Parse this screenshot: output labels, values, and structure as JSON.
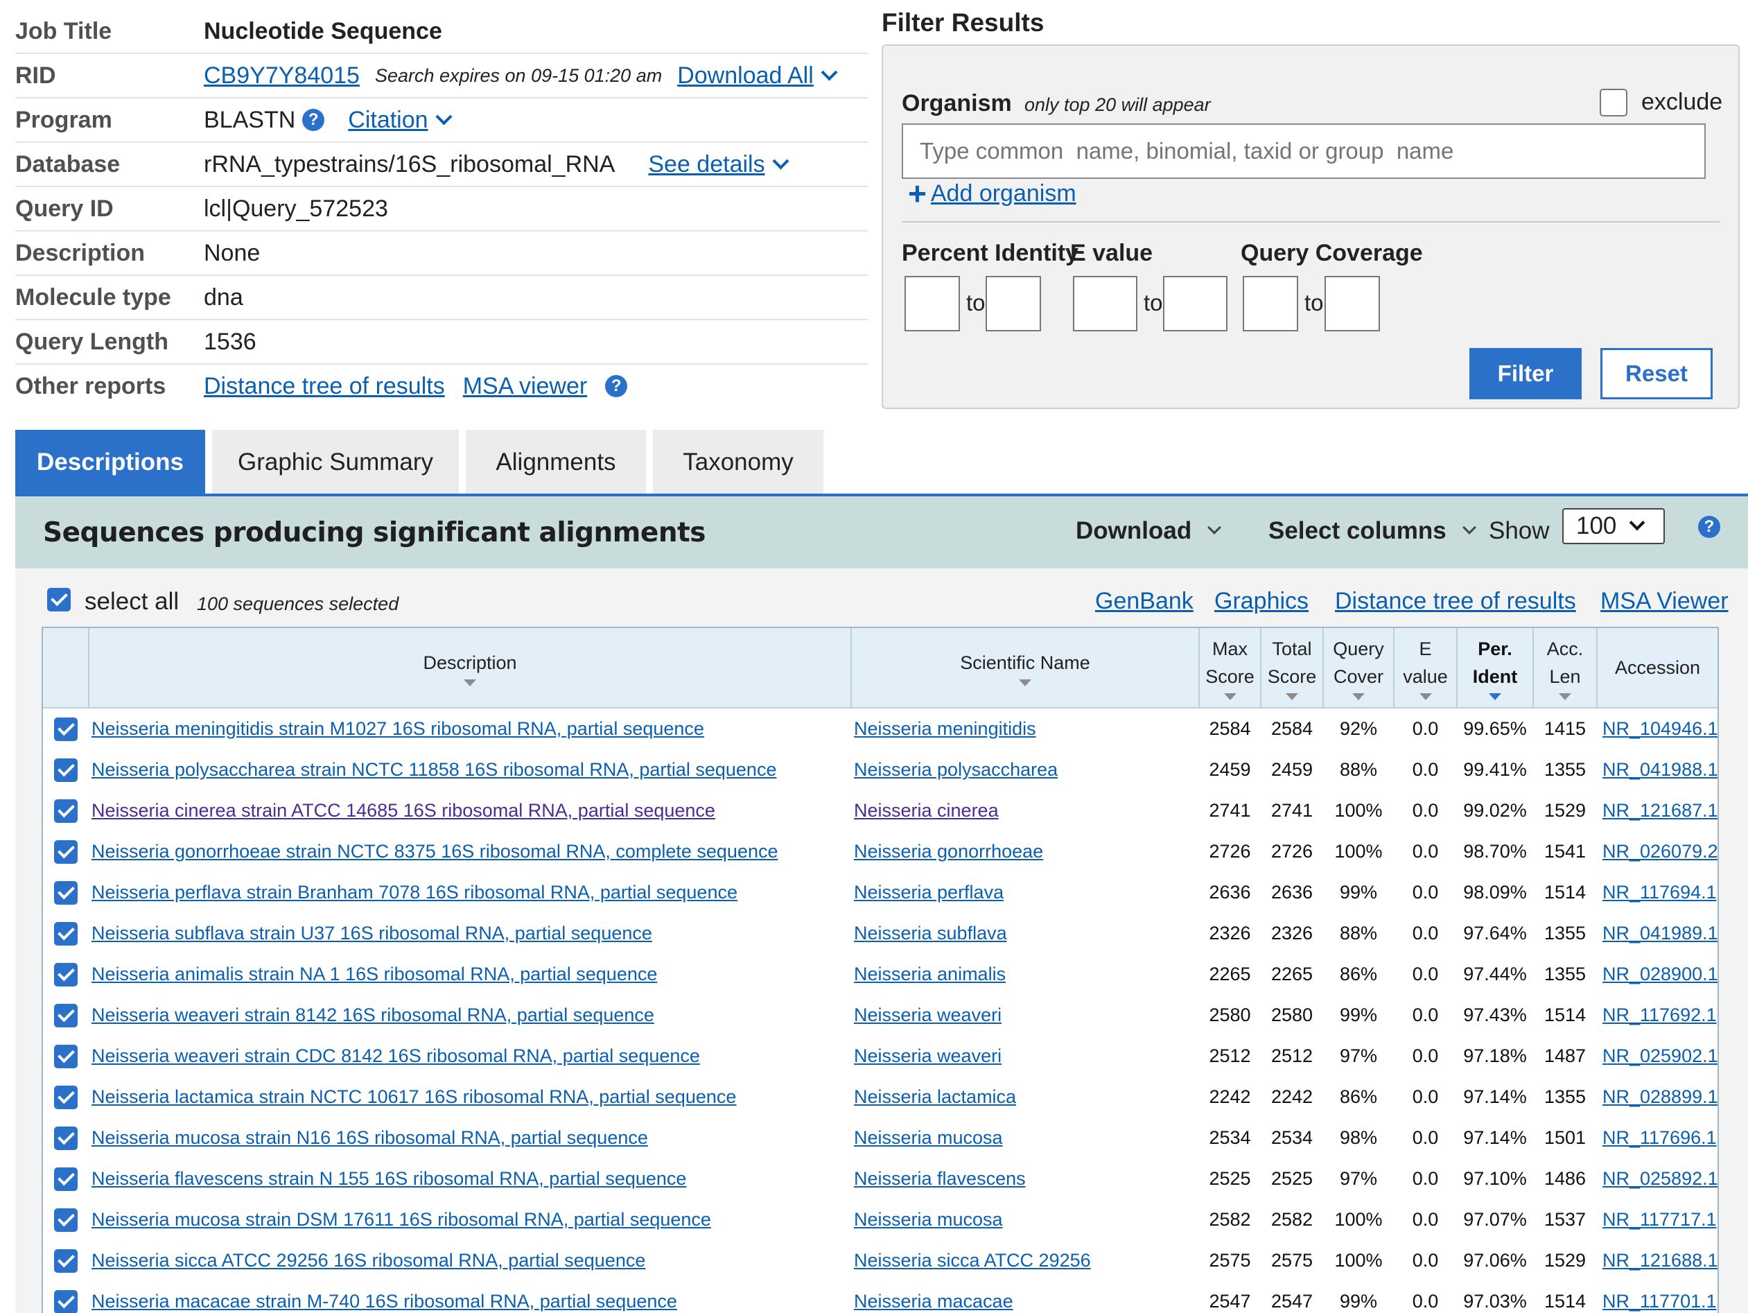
{
  "job": {
    "rows": [
      {
        "label": "Job Title",
        "value": "Nucleotide Sequence"
      },
      {
        "label": "RID",
        "value": "CB9Y7Y84015",
        "note": "Search expires on 09-15 01:20 am",
        "action": "Download All"
      },
      {
        "label": "Program",
        "value": "BLASTN",
        "action": "Citation"
      },
      {
        "label": "Database",
        "value": "rRNA_typestrains/16S_ribosomal_RNA",
        "action": "See details"
      },
      {
        "label": "Query ID",
        "value": "lcl|Query_572523"
      },
      {
        "label": "Description",
        "value": "None"
      },
      {
        "label": "Molecule type",
        "value": "dna"
      },
      {
        "label": "Query Length",
        "value": "1536"
      },
      {
        "label": "Other reports",
        "links": [
          "Distance tree of results",
          "MSA viewer"
        ]
      }
    ],
    "help_glyph": "?"
  },
  "filter": {
    "title": "Filter Results",
    "organism_label": "Organism",
    "organism_note": "only top 20 will appear",
    "exclude_label": "exclude",
    "organism_placeholder": "Type common  name, binomial, taxid or group  name",
    "add_organism": "Add organism",
    "plus_glyph": "+",
    "percent_identity": "Percent Identity",
    "evalue": "E value",
    "query_coverage": "Query Coverage",
    "to": "to",
    "filter_button": "Filter",
    "reset_button": "Reset"
  },
  "tabs": [
    "Descriptions",
    "Graphic Summary",
    "Alignments",
    "Taxonomy"
  ],
  "results": {
    "title": "Sequences producing significant alignments",
    "download": "Download",
    "select_columns": "Select columns",
    "show": "Show",
    "show_value": "100",
    "select_all": "select all",
    "selected_count": "100 sequences selected",
    "links": [
      "GenBank",
      "Graphics",
      "Distance tree of results",
      "MSA Viewer"
    ]
  },
  "columns": {
    "description": "Description",
    "scientific_name": "Scientific Name",
    "max_score": [
      "Max",
      "Score"
    ],
    "total_score": [
      "Total",
      "Score"
    ],
    "query_cover": [
      "Query",
      "Cover"
    ],
    "evalue": [
      "E",
      "value"
    ],
    "per_ident": [
      "Per.",
      "Ident"
    ],
    "acc_len": [
      "Acc.",
      "Len"
    ],
    "accession": "Accession"
  },
  "rows": [
    {
      "desc": "Neisseria meningitidis strain M1027 16S ribosomal RNA, partial sequence",
      "sci": "Neisseria meningitidis",
      "max": "2584",
      "total": "2584",
      "cover": "92%",
      "e": "0.0",
      "ident": "99.65%",
      "len": "1415",
      "acc": "NR_104946.1"
    },
    {
      "desc": "Neisseria polysaccharea strain NCTC 11858 16S ribosomal RNA, partial sequence",
      "sci": "Neisseria polysaccharea",
      "max": "2459",
      "total": "2459",
      "cover": "88%",
      "e": "0.0",
      "ident": "99.41%",
      "len": "1355",
      "acc": "NR_041988.1"
    },
    {
      "desc": "Neisseria cinerea strain ATCC 14685 16S ribosomal RNA, partial sequence",
      "sci": "Neisseria cinerea",
      "max": "2741",
      "total": "2741",
      "cover": "100%",
      "e": "0.0",
      "ident": "99.02%",
      "len": "1529",
      "acc": "NR_121687.1",
      "visited": true
    },
    {
      "desc": "Neisseria gonorrhoeae strain NCTC 8375 16S ribosomal RNA, complete sequence",
      "sci": "Neisseria gonorrhoeae",
      "max": "2726",
      "total": "2726",
      "cover": "100%",
      "e": "0.0",
      "ident": "98.70%",
      "len": "1541",
      "acc": "NR_026079.2"
    },
    {
      "desc": "Neisseria perflava strain Branham 7078 16S ribosomal RNA, partial sequence",
      "sci": "Neisseria perflava",
      "max": "2636",
      "total": "2636",
      "cover": "99%",
      "e": "0.0",
      "ident": "98.09%",
      "len": "1514",
      "acc": "NR_117694.1"
    },
    {
      "desc": "Neisseria subflava strain U37 16S ribosomal RNA, partial sequence",
      "sci": "Neisseria subflava",
      "max": "2326",
      "total": "2326",
      "cover": "88%",
      "e": "0.0",
      "ident": "97.64%",
      "len": "1355",
      "acc": "NR_041989.1"
    },
    {
      "desc": "Neisseria animalis strain NA 1 16S ribosomal RNA, partial sequence",
      "sci": "Neisseria animalis",
      "max": "2265",
      "total": "2265",
      "cover": "86%",
      "e": "0.0",
      "ident": "97.44%",
      "len": "1355",
      "acc": "NR_028900.1"
    },
    {
      "desc": "Neisseria weaveri strain 8142 16S ribosomal RNA, partial sequence",
      "sci": "Neisseria weaveri",
      "max": "2580",
      "total": "2580",
      "cover": "99%",
      "e": "0.0",
      "ident": "97.43%",
      "len": "1514",
      "acc": "NR_117692.1"
    },
    {
      "desc": "Neisseria weaveri strain CDC 8142 16S ribosomal RNA, partial sequence",
      "sci": "Neisseria weaveri",
      "max": "2512",
      "total": "2512",
      "cover": "97%",
      "e": "0.0",
      "ident": "97.18%",
      "len": "1487",
      "acc": "NR_025902.1"
    },
    {
      "desc": "Neisseria lactamica strain NCTC 10617 16S ribosomal RNA, partial sequence",
      "sci": "Neisseria lactamica",
      "max": "2242",
      "total": "2242",
      "cover": "86%",
      "e": "0.0",
      "ident": "97.14%",
      "len": "1355",
      "acc": "NR_028899.1"
    },
    {
      "desc": "Neisseria mucosa strain N16 16S ribosomal RNA, partial sequence",
      "sci": "Neisseria mucosa",
      "max": "2534",
      "total": "2534",
      "cover": "98%",
      "e": "0.0",
      "ident": "97.14%",
      "len": "1501",
      "acc": "NR_117696.1"
    },
    {
      "desc": "Neisseria flavescens strain N 155 16S ribosomal RNA, partial sequence",
      "sci": "Neisseria flavescens",
      "max": "2525",
      "total": "2525",
      "cover": "97%",
      "e": "0.0",
      "ident": "97.10%",
      "len": "1486",
      "acc": "NR_025892.1"
    },
    {
      "desc": "Neisseria mucosa strain DSM 17611 16S ribosomal RNA, partial sequence",
      "sci": "Neisseria mucosa",
      "max": "2582",
      "total": "2582",
      "cover": "100%",
      "e": "0.0",
      "ident": "97.07%",
      "len": "1537",
      "acc": "NR_117717.1"
    },
    {
      "desc": "Neisseria sicca ATCC 29256 16S ribosomal RNA, partial sequence",
      "sci": "Neisseria sicca ATCC 29256",
      "max": "2575",
      "total": "2575",
      "cover": "100%",
      "e": "0.0",
      "ident": "97.06%",
      "len": "1529",
      "acc": "NR_121688.1"
    },
    {
      "desc": "Neisseria macacae strain M-740 16S ribosomal RNA, partial sequence",
      "sci": "Neisseria macacae",
      "max": "2547",
      "total": "2547",
      "cover": "99%",
      "e": "0.0",
      "ident": "97.03%",
      "len": "1514",
      "acc": "NR_117701.1"
    }
  ],
  "colors": {
    "accent": "#2b70c9",
    "link": "#0b5fb0",
    "visited": "#4c2c92",
    "header_band": "#c8dcdc",
    "table_head": "#e2eff8"
  }
}
